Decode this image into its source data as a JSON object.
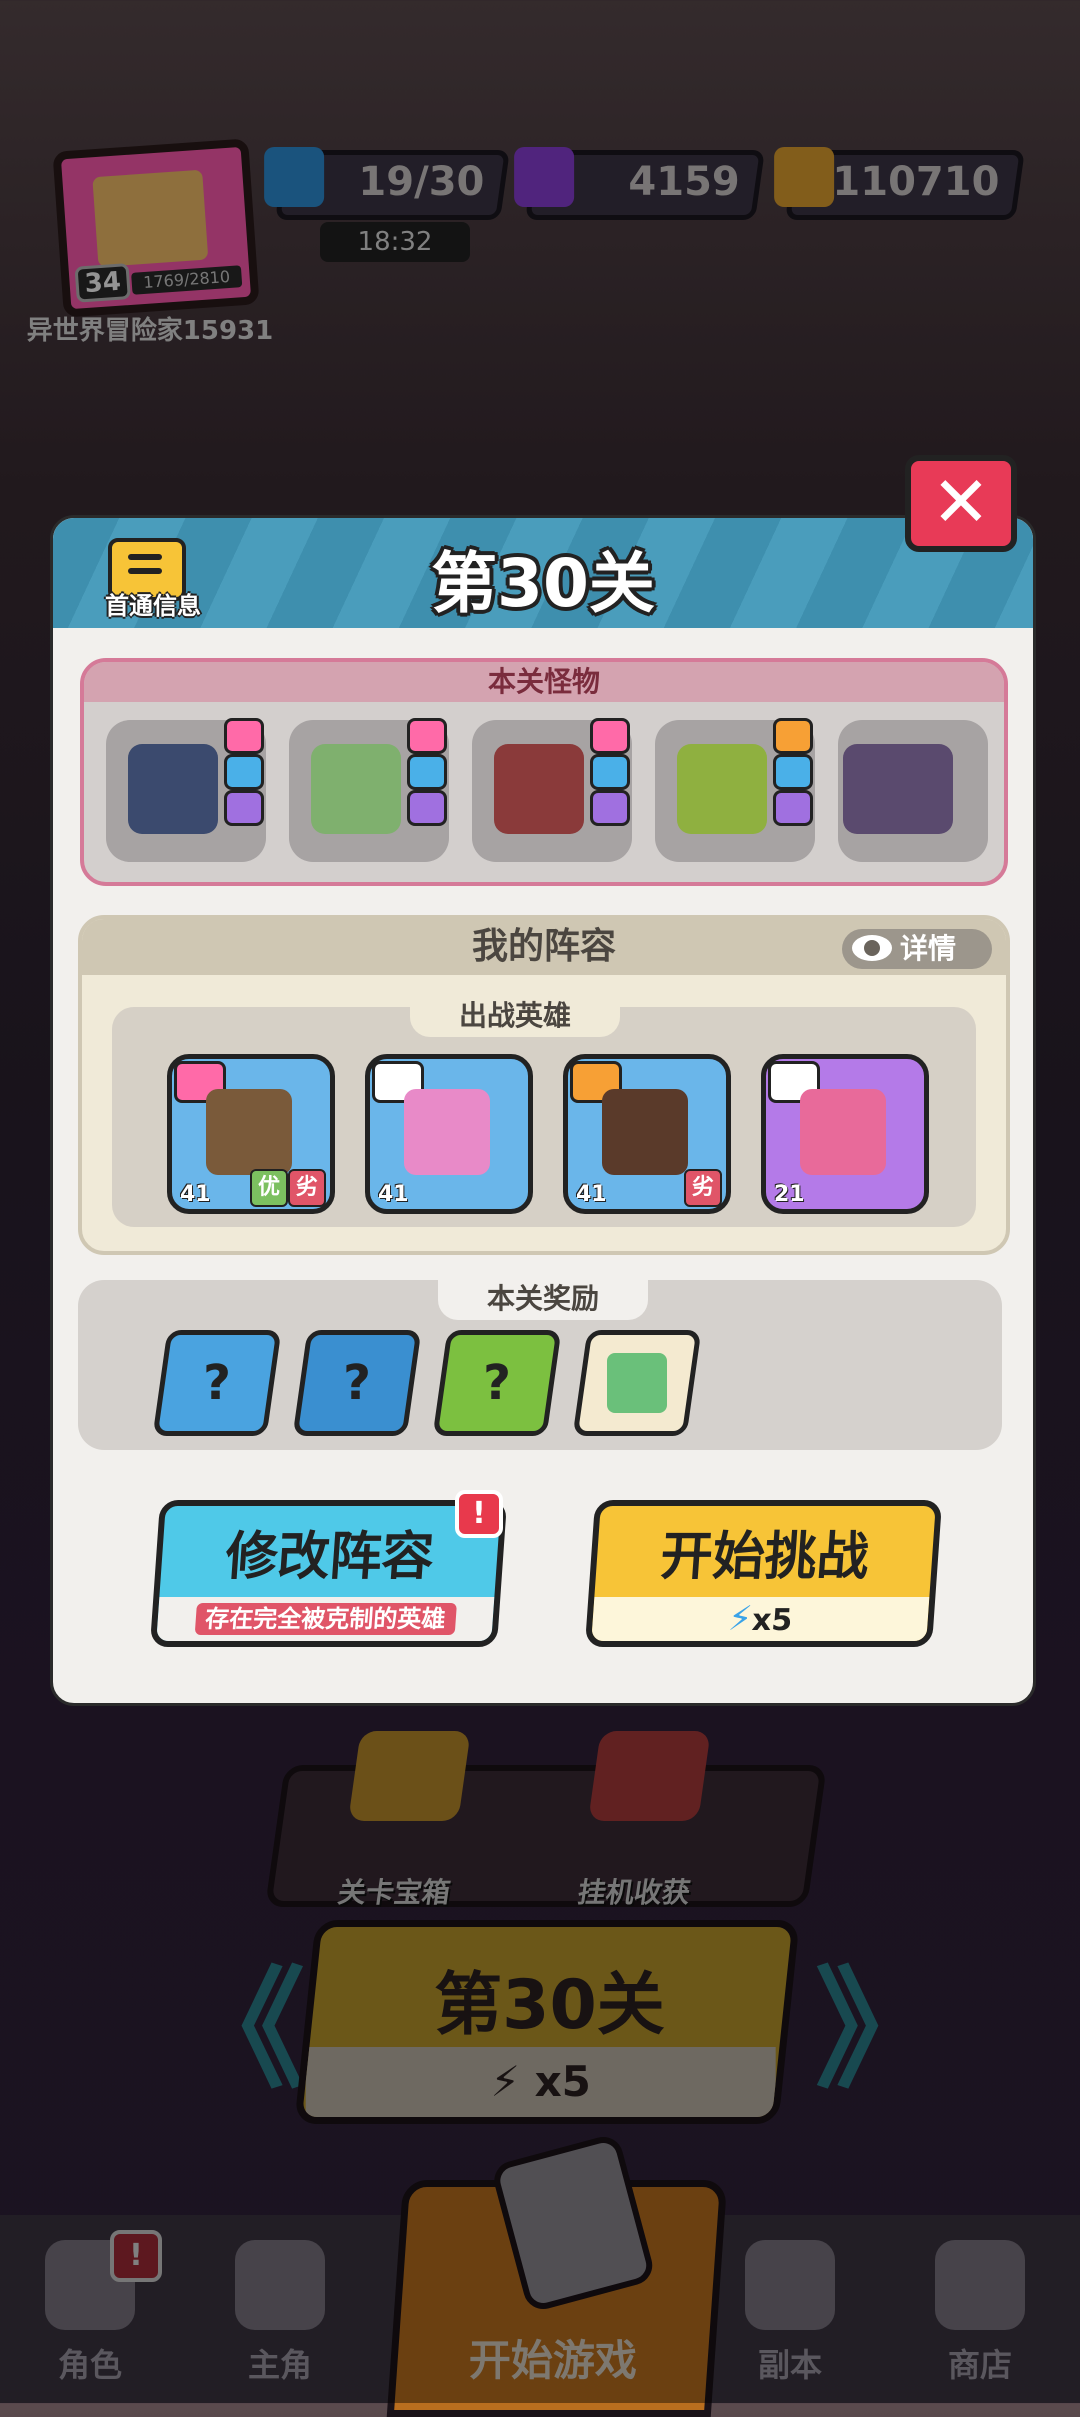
{
  "player": {
    "name": "异世界冒险家15931",
    "level": "34",
    "xp": "1769/2810"
  },
  "resources": {
    "energy": "19/30",
    "energy_timer": "18:32",
    "gems": "4159",
    "coins": "110710"
  },
  "modal": {
    "title": "第30关",
    "info_label": "首通信息",
    "close_glyph": "✕",
    "monsters": {
      "header": "本关怪物",
      "items": [
        {
          "name": "goat-demon"
        },
        {
          "name": "green-orc"
        },
        {
          "name": "red-ogre"
        },
        {
          "name": "zombie-head"
        },
        {
          "name": "hat-witch"
        }
      ]
    },
    "lineup": {
      "header": "我的阵容",
      "detail_label": "详情",
      "heroes_header": "出战英雄",
      "heroes": [
        {
          "level": "41",
          "tags": [
            "优",
            "劣"
          ]
        },
        {
          "level": "41",
          "tags": []
        },
        {
          "level": "41",
          "tags": [
            "劣"
          ]
        },
        {
          "level": "21",
          "tags": []
        }
      ]
    },
    "rewards": {
      "header": "本关奖励",
      "items": [
        "?",
        "?",
        "?",
        ""
      ]
    },
    "modify_button": {
      "label": "修改阵容",
      "warning": "存在完全被克制的英雄",
      "alert": "!"
    },
    "start_button": {
      "label": "开始挑战",
      "cost": "x5"
    }
  },
  "background": {
    "chest_label": "关卡宝箱",
    "idle_label": "挂机收获",
    "stage_title": "第30关",
    "stage_cost": "x5",
    "prev_arrow": "《",
    "next_arrow": "》"
  },
  "nav": {
    "items": [
      "角色",
      "主角",
      "开始游戏",
      "副本",
      "商店"
    ],
    "alert": "!"
  },
  "colors": {
    "modal_header": "#3e8fae",
    "modify_button": "#4fc9e8",
    "start_button": "#f7c437",
    "close_button": "#e83a57",
    "monster_border": "#d57a98"
  }
}
